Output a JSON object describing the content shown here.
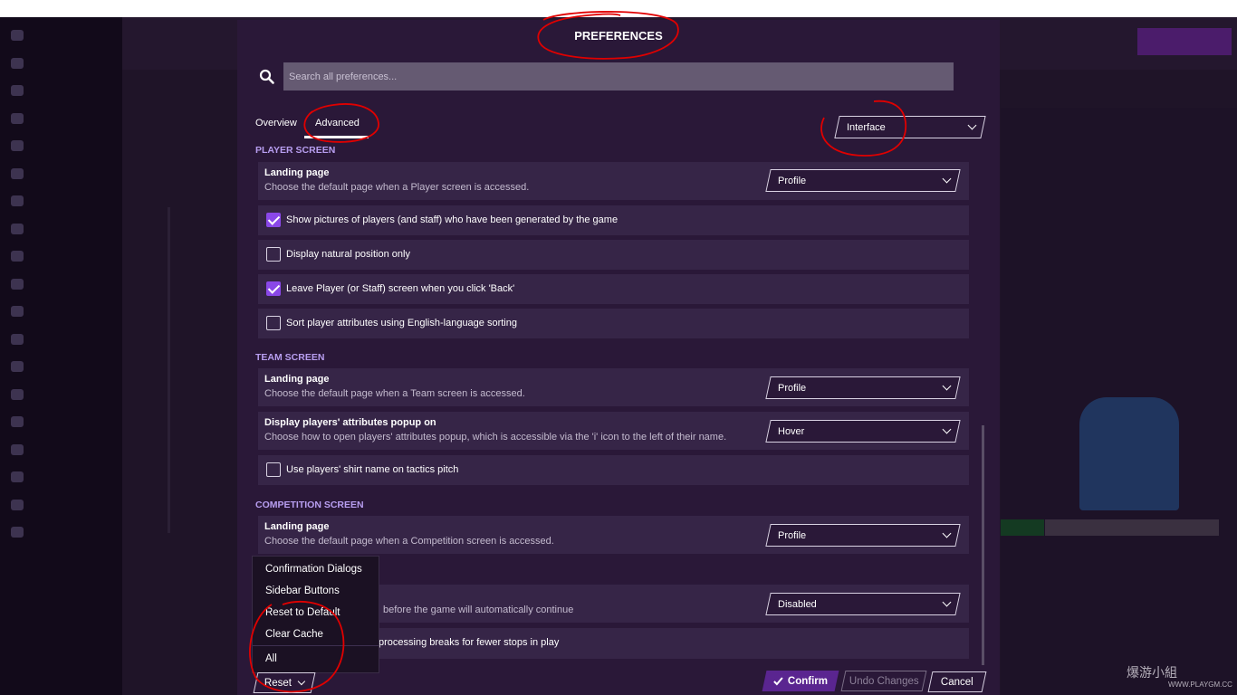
{
  "modal": {
    "title": "PREFERENCES",
    "search_placeholder": "Search all preferences...",
    "tabs": [
      {
        "label": "Overview"
      },
      {
        "label": "Advanced",
        "active": true
      }
    ],
    "category_dropdown": "Interface"
  },
  "sections": {
    "player_screen": {
      "title": "PLAYER SCREEN",
      "landing_title": "Landing page",
      "landing_desc": "Choose the default page when a Player screen is accessed.",
      "landing_value": "Profile",
      "checkboxes": [
        {
          "label": "Show pictures of players (and staff) who have been generated by the game",
          "checked": true
        },
        {
          "label": "Display natural position only",
          "checked": false
        },
        {
          "label": "Leave Player (or Staff) screen when you click 'Back'",
          "checked": true
        },
        {
          "label": "Sort player attributes using English-language sorting",
          "checked": false
        }
      ]
    },
    "team_screen": {
      "title": "TEAM SCREEN",
      "landing_title": "Landing page",
      "landing_desc": "Choose the default page when a Team screen is accessed.",
      "landing_value": "Profile",
      "popup_title": "Display players' attributes popup on",
      "popup_desc": "Choose how to open players' attributes popup, which is accessible via the 'i' icon to the left of their name.",
      "popup_value": "Hover",
      "shirt_label": "Use players' shirt name on tactics pitch",
      "shirt_checked": false
    },
    "competition_screen": {
      "title": "COMPETITION SCREEN",
      "landing_title": "Landing page",
      "landing_desc": "Choose the default page when a Competition screen is accessed.",
      "landing_value": "Profile"
    },
    "partial": {
      "continue_desc": "before the game will automatically continue",
      "continue_value": "Disabled",
      "breaks_desc": "processing breaks for fewer stops in play"
    }
  },
  "reset_menu": {
    "items": [
      "Confirmation Dialogs",
      "Sidebar Buttons",
      "Reset to Default",
      "Clear Cache"
    ],
    "all": "All"
  },
  "footer": {
    "reset": "Reset",
    "confirm": "Confirm",
    "undo": "Undo Changes",
    "cancel": "Cancel"
  },
  "watermark": {
    "text": "爆游小組",
    "url": "WWW.PLAYGM.CC"
  },
  "colors": {
    "accent": "#8a48e8",
    "section": "#b89ef0",
    "modal_bg": "#2a1838",
    "annotation": "#e00000"
  }
}
